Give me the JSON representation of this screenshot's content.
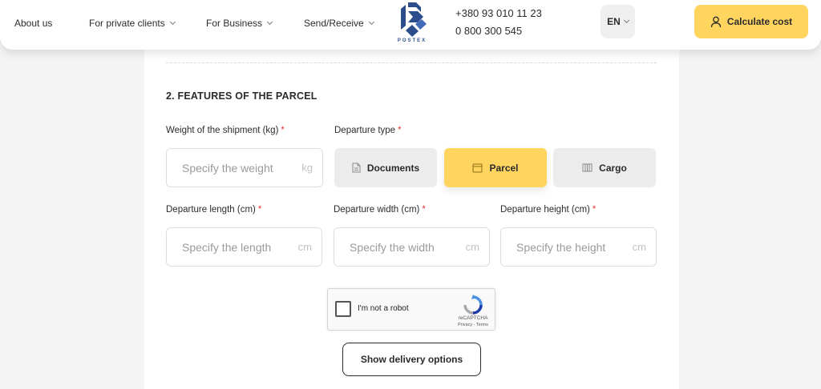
{
  "header": {
    "nav": [
      {
        "label": "About us",
        "has_dropdown": false
      },
      {
        "label": "For private clients",
        "has_dropdown": true
      },
      {
        "label": "For Business",
        "has_dropdown": true
      },
      {
        "label": "Send/Receive",
        "has_dropdown": true
      }
    ],
    "logo_text": "POSTEX",
    "phones": [
      "+380 93 010 11 23",
      "0 800 300 545"
    ],
    "language": "EN",
    "cta_label": "Calculate cost",
    "cta_icon": "user-icon",
    "colors": {
      "accent": "#ffd560",
      "logo_blue": "#2b4d8c"
    }
  },
  "section": {
    "title": "2. FEATURES OF THE PARCEL",
    "weight": {
      "label": "Weight of the shipment (kg)",
      "required_mark": "*",
      "placeholder": "Specify the weight",
      "unit": "kg",
      "value": ""
    },
    "departure_type": {
      "label": "Departure type",
      "required_mark": "*",
      "options": [
        {
          "label": "Documents",
          "icon": "document-icon",
          "selected": false
        },
        {
          "label": "Parcel",
          "icon": "box-icon",
          "selected": true
        },
        {
          "label": "Cargo",
          "icon": "pallet-icon",
          "selected": false
        }
      ]
    },
    "length": {
      "label": "Departure length (cm)",
      "required_mark": "*",
      "placeholder": "Specify the length",
      "unit": "cm",
      "value": ""
    },
    "width": {
      "label": "Departure width (cm)",
      "required_mark": "*",
      "placeholder": "Specify the width",
      "unit": "cm",
      "value": ""
    },
    "height": {
      "label": "Departure height (cm)",
      "required_mark": "*",
      "placeholder": "Specify the height",
      "unit": "cm",
      "value": ""
    }
  },
  "recaptcha": {
    "label": "I'm not a robot",
    "brand": "reCAPTCHA",
    "links": "Privacy - Terms",
    "checked": false
  },
  "submit_label": "Show delivery options"
}
